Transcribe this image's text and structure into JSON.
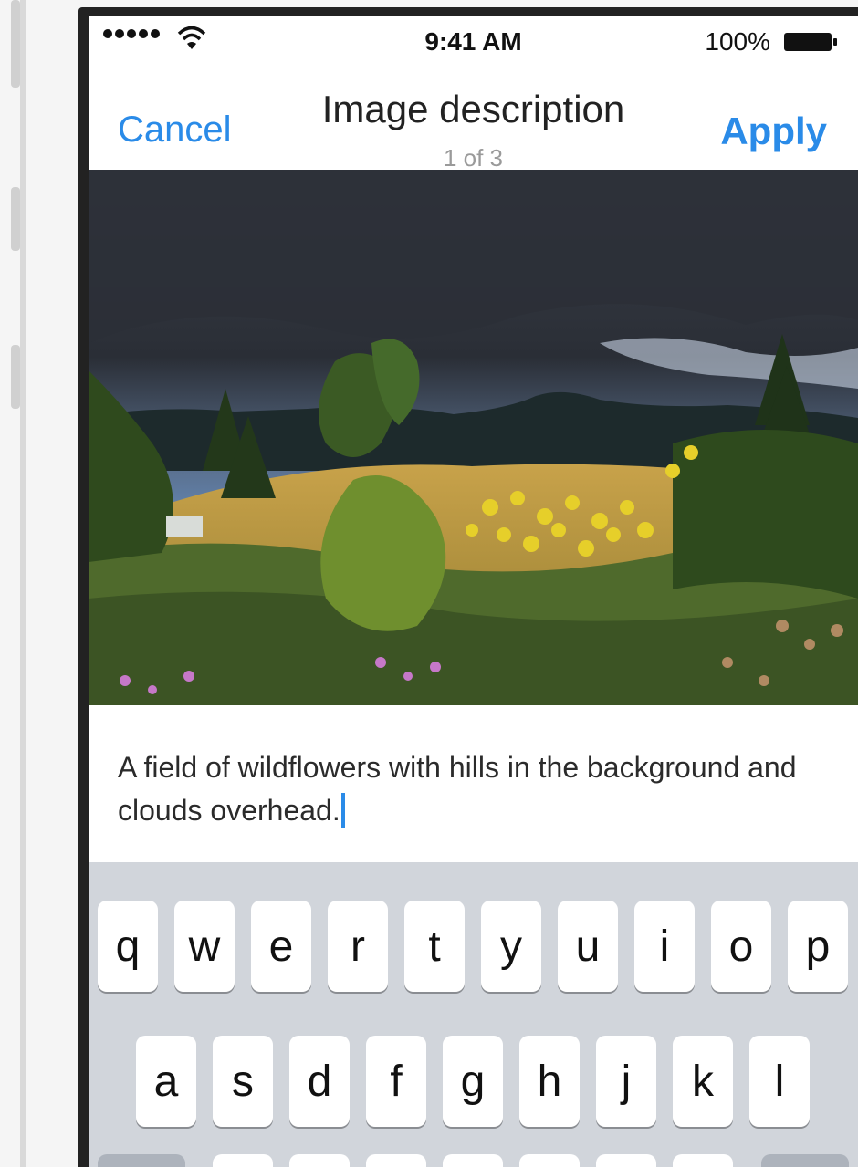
{
  "status_bar": {
    "time": "9:41 AM",
    "battery_label": "100%",
    "signal_icon": "signal-dots-icon",
    "wifi_icon": "wifi-icon",
    "battery_icon": "battery-icon"
  },
  "nav": {
    "cancel_label": "Cancel",
    "title": "Image description",
    "subtitle": "1 of 3",
    "apply_label": "Apply"
  },
  "photo": {
    "subject": "landscape-photo"
  },
  "description": {
    "text": "A field of wildflowers with hills in the background and clouds overhead."
  },
  "keyboard": {
    "row1": [
      "q",
      "w",
      "e",
      "r",
      "t",
      "y",
      "u",
      "i",
      "o",
      "p"
    ],
    "row2": [
      "a",
      "s",
      "d",
      "f",
      "g",
      "h",
      "j",
      "k",
      "l"
    ]
  },
  "colors": {
    "accent": "#2a8be8",
    "keyboard_bg": "#d1d5db"
  }
}
